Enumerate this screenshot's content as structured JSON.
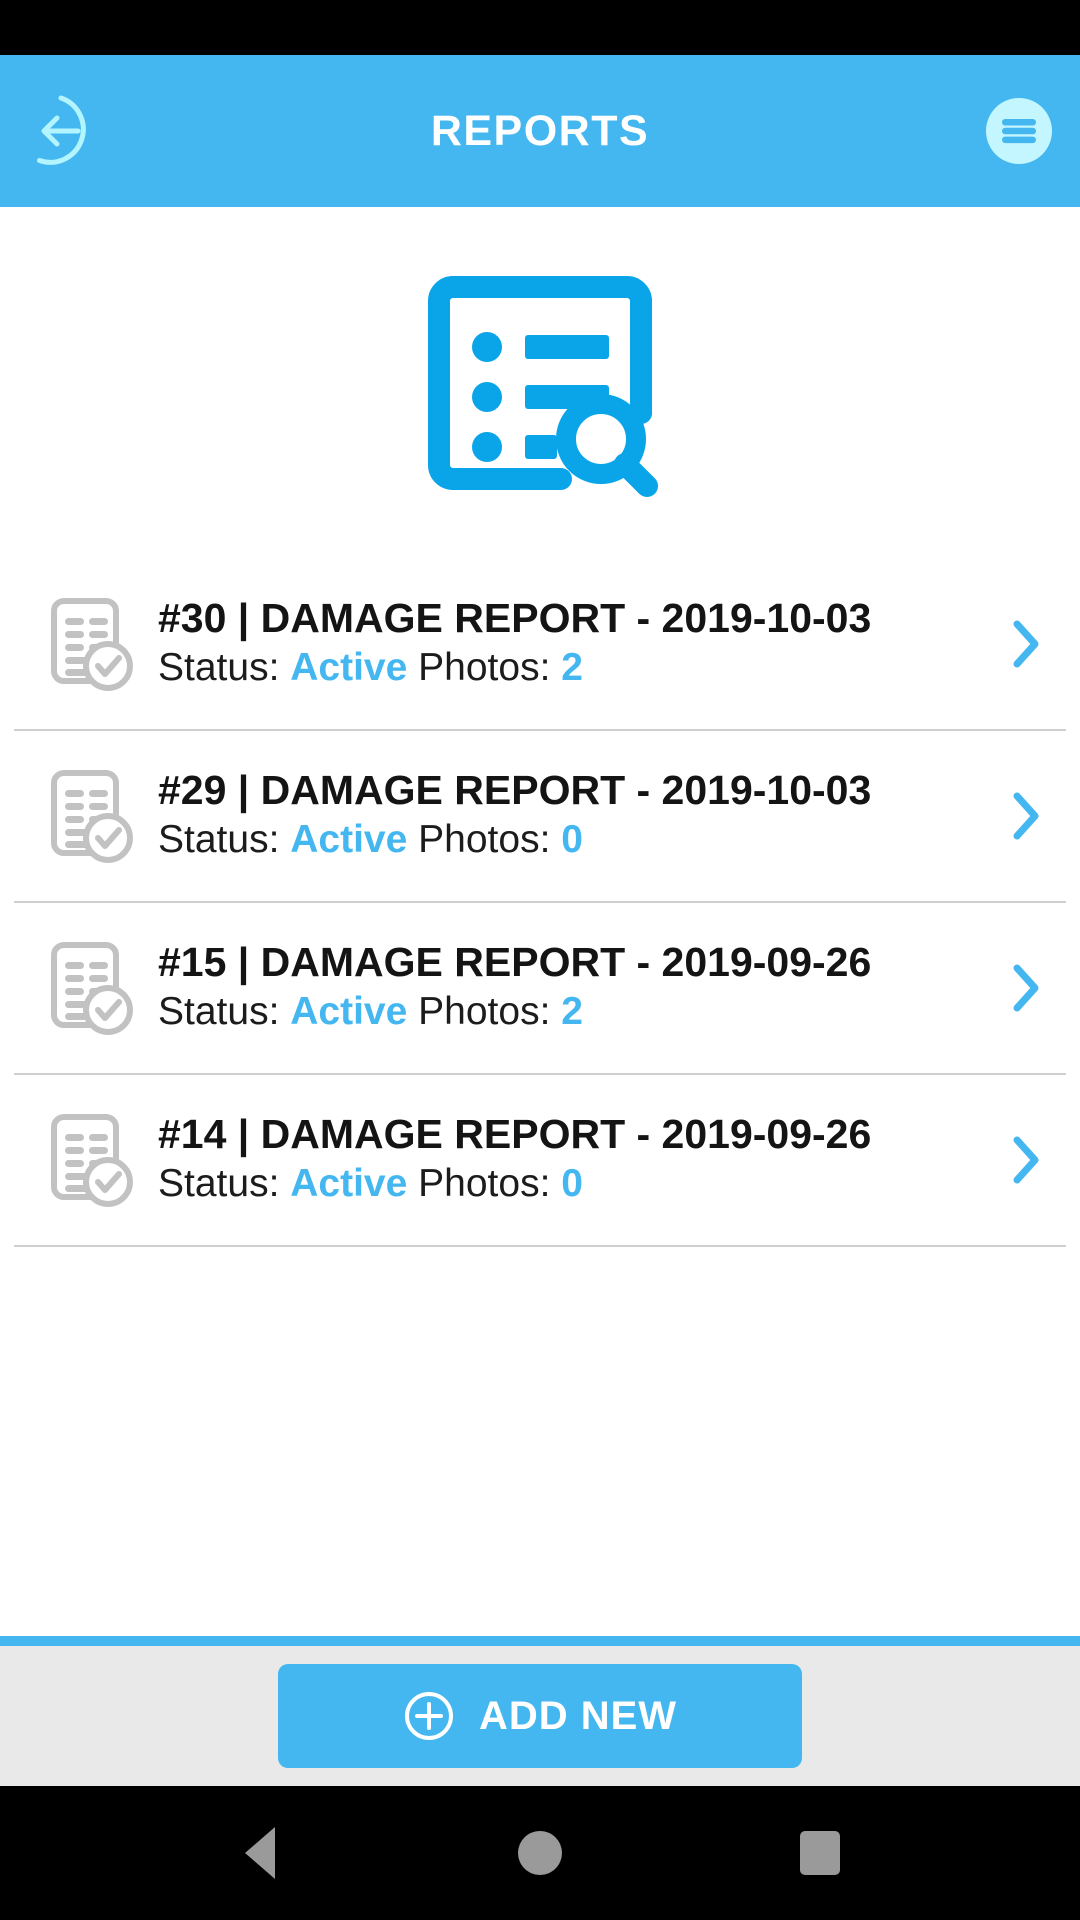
{
  "app_bar": {
    "title": "REPORTS",
    "back_icon": "arrow-left-circle-icon",
    "menu_icon": "hamburger-menu-icon",
    "bg_color": "#44b7f0",
    "icon_color": "#b3f5ff"
  },
  "hero": {
    "icon": "report-list-search-icon",
    "color": "#0aa5e8"
  },
  "list": {
    "status_label": "Status:",
    "photos_label": "Photos:",
    "chevron_icon": "chevron-right-icon",
    "row_icon": "document-check-icon",
    "accent_color": "#44b7f0",
    "rows": [
      {
        "title": "#30 | DAMAGE REPORT - 2019-10-03",
        "id": "#30",
        "name": "DAMAGE REPORT",
        "date": "2019-10-03",
        "status": "Active",
        "photos": "2"
      },
      {
        "title": "#29 | DAMAGE REPORT - 2019-10-03",
        "id": "#29",
        "name": "DAMAGE REPORT",
        "date": "2019-10-03",
        "status": "Active",
        "photos": "0"
      },
      {
        "title": "#15 | DAMAGE REPORT - 2019-09-26",
        "id": "#15",
        "name": "DAMAGE REPORT",
        "date": "2019-09-26",
        "status": "Active",
        "photos": "2"
      },
      {
        "title": "#14 | DAMAGE REPORT - 2019-09-26",
        "id": "#14",
        "name": "DAMAGE REPORT",
        "date": "2019-09-26",
        "status": "Active",
        "photos": "0"
      }
    ]
  },
  "footer": {
    "add_label": "ADD NEW",
    "add_icon": "plus-circle-icon",
    "bg_color": "#e9e9e9",
    "button_color": "#44b7f0"
  },
  "nav_bar": {
    "back_icon": "nav-back-triangle-icon",
    "home_icon": "nav-home-circle-icon",
    "recent_icon": "nav-recents-square-icon"
  }
}
